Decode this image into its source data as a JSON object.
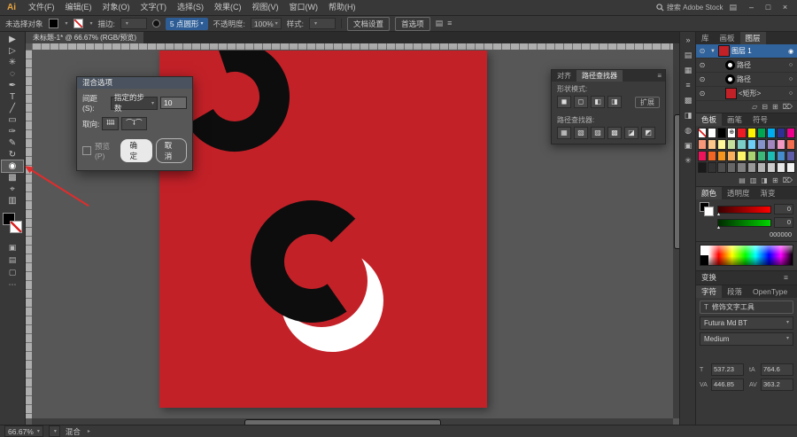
{
  "titlebar": {
    "logo": "Ai",
    "menus": [
      "文件(F)",
      "编辑(E)",
      "对象(O)",
      "文字(T)",
      "选择(S)",
      "效果(C)",
      "视图(V)",
      "窗口(W)",
      "帮助(H)"
    ],
    "search_text": "搜索 Adobe Stock",
    "window_buttons": [
      "–",
      "□",
      "×"
    ]
  },
  "options_bar": {
    "no_selection_label": "未选择对象",
    "stroke_label": "描边:",
    "brush_label": "5 点圆形",
    "opacity_label": "不透明度:",
    "opacity_value": "100%",
    "style_label": "样式:",
    "doc_setup_label": "文档设置",
    "preferences_label": "首选项",
    "right_icons": [
      {
        "name": "arrange-documents-icon",
        "glyph": "▤"
      },
      {
        "name": "workspace-menu-icon",
        "glyph": "≡"
      }
    ]
  },
  "document_tab": {
    "title": "未标题-1* @ 66.67% (RGB/预览)"
  },
  "toolbar": {
    "tools": [
      {
        "name": "selection-tool",
        "glyph": "▶"
      },
      {
        "name": "direct-selection-tool",
        "glyph": "▷"
      },
      {
        "name": "magic-wand-tool",
        "glyph": "✳"
      },
      {
        "name": "lasso-tool",
        "glyph": "◌"
      },
      {
        "name": "pen-tool",
        "glyph": "✒"
      },
      {
        "name": "type-tool",
        "glyph": "T"
      },
      {
        "name": "line-segment-tool",
        "glyph": "╱"
      },
      {
        "name": "rectangle-tool",
        "glyph": "▭"
      },
      {
        "name": "paintbrush-tool",
        "glyph": "✑"
      },
      {
        "name": "pencil-tool",
        "glyph": "✎"
      },
      {
        "name": "rotate-tool",
        "glyph": "↻"
      },
      {
        "name": "blend-tool",
        "glyph": "◉",
        "active": true
      },
      {
        "name": "gradient-tool",
        "glyph": "▩"
      },
      {
        "name": "eyedropper-tool",
        "glyph": "⌖"
      },
      {
        "name": "column-graph-tool",
        "glyph": "▥"
      }
    ],
    "bottom_icons": [
      {
        "name": "fill-color-mode-icon",
        "glyph": "▣"
      },
      {
        "name": "gradient-mode-icon",
        "glyph": "▤"
      },
      {
        "name": "screen-mode-icon",
        "glyph": "▢"
      },
      {
        "name": "more-tools-icon",
        "glyph": "⋯"
      }
    ]
  },
  "dialog": {
    "title": "混合选项",
    "spacing_label": "间距(S):",
    "spacing_value": "指定的步数",
    "steps_value": "10",
    "orientation_label": "取向:",
    "orient_page_glyph": "ʇʇʇʇ",
    "orient_path_glyph": "⌒ʇ⌒",
    "preview_label": "预览(P)",
    "ok_label": "确定",
    "cancel_label": "取消"
  },
  "pathfinder": {
    "tabs": [
      "对齐",
      "路径查找器"
    ],
    "menu_glyph": "≡",
    "shape_label": "形状模式:",
    "expand_label": "扩展",
    "pf_label": "路径查找器:",
    "shape_icons": [
      {
        "name": "unite-icon",
        "glyph": "◼"
      },
      {
        "name": "minus-front-icon",
        "glyph": "◻"
      },
      {
        "name": "intersect-icon",
        "glyph": "◧"
      },
      {
        "name": "exclude-icon",
        "glyph": "◨"
      }
    ],
    "pf_icons": [
      {
        "name": "divide-icon",
        "glyph": "▦"
      },
      {
        "name": "trim-icon",
        "glyph": "▧"
      },
      {
        "name": "merge-icon",
        "glyph": "▨"
      },
      {
        "name": "crop-icon",
        "glyph": "▩"
      },
      {
        "name": "outline-icon",
        "glyph": "◪"
      },
      {
        "name": "minus-back-icon",
        "glyph": "◩"
      }
    ]
  },
  "right_strip": {
    "icons": [
      {
        "name": "expand-panels-icon",
        "glyph": "»"
      },
      {
        "name": "color-panel-icon",
        "glyph": "▤"
      },
      {
        "name": "color-guide-panel-icon",
        "glyph": "▦"
      },
      {
        "name": "stroke-panel-icon",
        "glyph": "≡"
      },
      {
        "name": "gradient-panel-icon",
        "glyph": "▩"
      },
      {
        "name": "transparency-panel-icon",
        "glyph": "◨"
      },
      {
        "name": "appearance-panel-icon",
        "glyph": "◍"
      },
      {
        "name": "graphic-styles-panel-icon",
        "glyph": "▣"
      },
      {
        "name": "symbols-panel-icon",
        "glyph": "✳"
      }
    ]
  },
  "right_dock": {
    "panel_tabs": [
      "库",
      "画板",
      "图层"
    ],
    "layers": {
      "rows": [
        {
          "label": "图层 1",
          "selected": true,
          "indent": 0,
          "expander": "▼",
          "thumb": "#c32128",
          "eye": "⊙"
        },
        {
          "label": "路径",
          "indent": 1,
          "thumb": "ring",
          "eye": "⊙"
        },
        {
          "label": "路径",
          "indent": 1,
          "thumb": "ring",
          "eye": "⊙"
        },
        {
          "label": "<矩形>",
          "indent": 1,
          "thumb": "#c32128",
          "eye": "⊙"
        }
      ],
      "buttons": [
        {
          "name": "make-mask-button",
          "glyph": "▱"
        },
        {
          "name": "new-sublayer-button",
          "glyph": "⊟"
        },
        {
          "name": "new-layer-button",
          "glyph": "⊞"
        },
        {
          "name": "delete-layer-button",
          "glyph": "⌦"
        }
      ]
    },
    "swatches": {
      "tabs": [
        "色板",
        "画笔",
        "符号"
      ],
      "colors": [
        "none",
        "#ffffff",
        "#000000",
        "reg",
        "#ed1c24",
        "#fff200",
        "#00a651",
        "#00aeef",
        "#2e3192",
        "#ec008c",
        "#f7977a",
        "#fdc68a",
        "#fff79a",
        "#c4df9b",
        "#7bcdc8",
        "#6ecff6",
        "#8493ca",
        "#a187be",
        "#f49ac2",
        "#f26c4f",
        "#ed145b",
        "#f26522",
        "#f7941d",
        "#fbaf5c",
        "#fff568",
        "#acd372",
        "#3cb878",
        "#1cbbb4",
        "#448ccb",
        "#5e5ca7",
        "#1a1a1a",
        "#333333",
        "#4d4d4d",
        "#666666",
        "#808080",
        "#999999",
        "#b3b3b3",
        "#cccccc",
        "#e6e6e6",
        "#f2f2f2"
      ],
      "buttons": [
        {
          "name": "swatch-libraries-button",
          "glyph": "▤"
        },
        {
          "name": "swatch-kinds-button",
          "glyph": "▥"
        },
        {
          "name": "swatch-options-button",
          "glyph": "◨"
        },
        {
          "name": "new-swatch-button",
          "glyph": "⊞"
        },
        {
          "name": "delete-swatch-button",
          "glyph": "⌦"
        }
      ]
    },
    "color_panel": {
      "tabs": [
        "颜色",
        "透明度",
        "渐变"
      ],
      "sliders": [
        {
          "value": "0",
          "from": "#3a0000",
          "to": "#ff0000"
        },
        {
          "value": "0",
          "from": "#002a00",
          "to": "#00d400"
        }
      ],
      "hex": "000000"
    },
    "transform_label": "变换",
    "character": {
      "tabs": [
        "字符",
        "段落",
        "OpenType"
      ],
      "touch_type_label": "修饰文字工具",
      "font_value": "Futura Md BT",
      "style_value": "Medium",
      "fields": [
        {
          "label": "T",
          "value": "537.23"
        },
        {
          "label": "tA",
          "value": "764.6"
        },
        {
          "label": "VA",
          "value": "446.85"
        },
        {
          "label": "AV",
          "value": "363.2"
        }
      ]
    }
  },
  "status_bar": {
    "zoom": "66.67%",
    "tool": "混合"
  },
  "colors": {
    "artboard": "#c32128",
    "selection_blue": "#31639c",
    "annotation": "#e32b2b"
  }
}
